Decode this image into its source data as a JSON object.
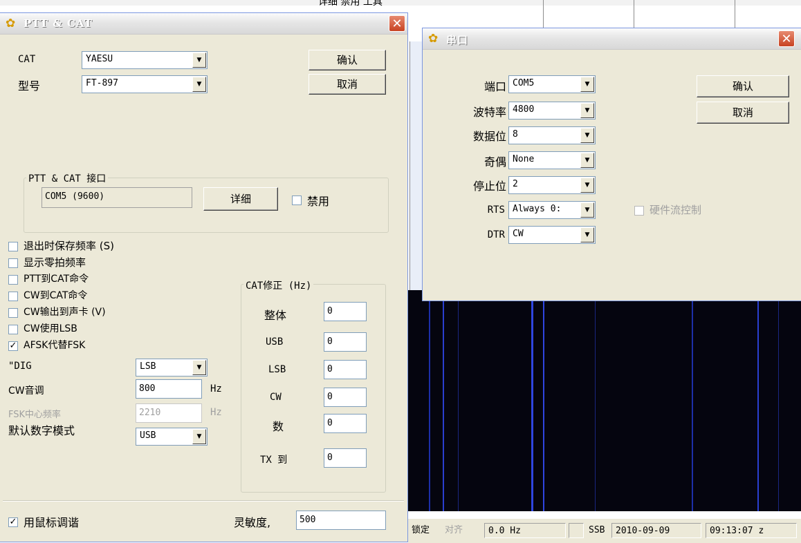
{
  "background": {
    "top_text": "详细  禁用  工具",
    "status": {
      "lock": "锁定",
      "align": "对齐",
      "freq": "0.0 Hz",
      "mode": "SSB",
      "date": "2010-09-09",
      "time": "09:13:07 z"
    },
    "colors": {
      "waterfall": "#05050f",
      "line": "#2a3fd0"
    }
  },
  "ptt_window": {
    "title": "PTT & CAT",
    "close_icon": "close-icon",
    "cat_label": "CAT",
    "cat_value": "YAESU",
    "model_label": "型号",
    "model_value": "FT-897",
    "ok_button": "确认",
    "cancel_button": "取消",
    "interface_group": "PTT & CAT 接口",
    "port_value": "COM5 (9600)",
    "detail_button": "详细",
    "disable_label": "禁用",
    "checkboxes": [
      {
        "label": "退出时保存频率 (S)",
        "checked": false
      },
      {
        "label": "显示零拍频率",
        "checked": false
      },
      {
        "label": "PTT到CAT命令",
        "checked": false
      },
      {
        "label": "CW到CAT命令",
        "checked": false
      },
      {
        "label": "CW输出到声卡 (V)",
        "checked": false
      },
      {
        "label": "CW使用LSB",
        "checked": false
      },
      {
        "label": "AFSK代替FSK",
        "checked": true
      }
    ],
    "dig_label": "\"DIG",
    "dig_value": "LSB",
    "cw_tone_label": "CW音调",
    "cw_tone_value": "800",
    "cw_tone_unit": "Hz",
    "fsk_label": "FSK中心频率",
    "fsk_value": "2210",
    "fsk_unit": "Hz",
    "default_mode_label": "默认数字模式",
    "default_mode_value": "USB",
    "cat_correction": {
      "title": "CAT修正 (Hz)",
      "rows": [
        {
          "label": "整体",
          "value": "0"
        },
        {
          "label": "USB",
          "value": "0"
        },
        {
          "label": "LSB",
          "value": "0"
        },
        {
          "label": "CW",
          "value": "0"
        },
        {
          "label": "数",
          "value": "0"
        },
        {
          "label": "TX 到",
          "value": "0"
        }
      ]
    },
    "mouse_tune_label": "用鼠标调谐",
    "mouse_tune_checked": true,
    "sensitivity_label": "灵敏度,",
    "sensitivity_value": "500"
  },
  "serial_window": {
    "title": "串口",
    "ok_button": "确认",
    "cancel_button": "取消",
    "rows": [
      {
        "label": "端口",
        "value": "COM5"
      },
      {
        "label": "波特率",
        "value": "4800"
      },
      {
        "label": "数据位",
        "value": "8"
      },
      {
        "label": "奇偶",
        "value": "None"
      },
      {
        "label": "停止位",
        "value": "2"
      },
      {
        "label": "RTS",
        "value": "Always 0:"
      },
      {
        "label": "DTR",
        "value": "CW"
      }
    ],
    "flow_control_label": "硬件流控制"
  }
}
